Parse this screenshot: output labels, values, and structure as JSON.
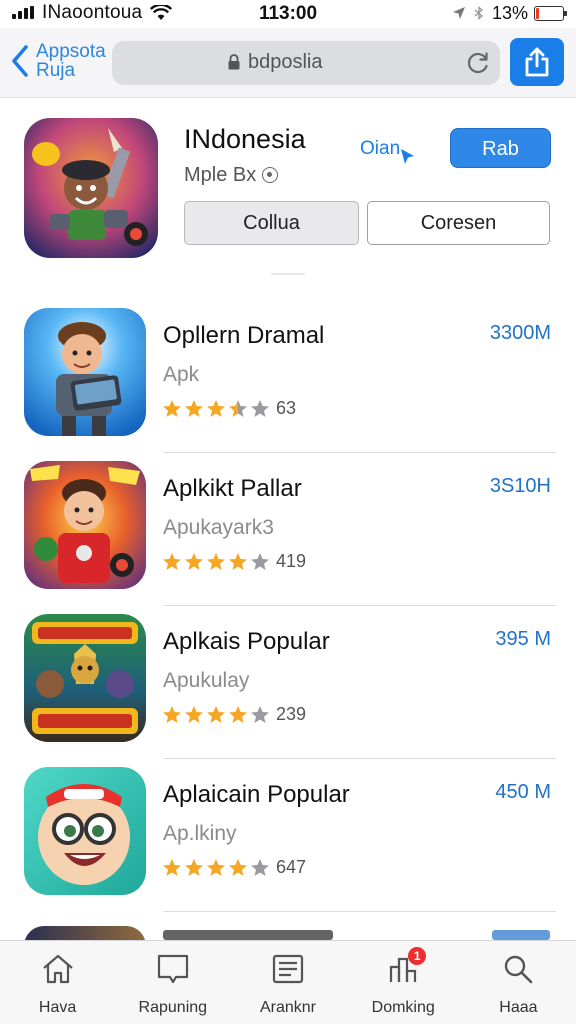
{
  "status_bar": {
    "carrier": "INaoontoua",
    "time": "113:00",
    "battery_percent": "13%",
    "battery_level": 0.13
  },
  "nav": {
    "back_label_line1": "Appsota",
    "back_label_line2": "Ruja",
    "url": "bdposlia",
    "accent": "#1a7ee8"
  },
  "featured": {
    "title": "INdonesia",
    "subtitle": "Mple Bx",
    "link": "Oian",
    "get_label": "Rab",
    "segment_1": "Collua",
    "segment_2": "Coresen"
  },
  "apps": [
    {
      "name": "Opllern Dramal",
      "subtitle": "Apk",
      "rating": 3.5,
      "rating_count": "63",
      "size": "3300M"
    },
    {
      "name": "Aplkikt Pallar",
      "subtitle": "Apukayark3",
      "rating": 4,
      "rating_count": "419",
      "size": "3S10H"
    },
    {
      "name": "Aplkais Popular",
      "subtitle": "Apukulay",
      "rating": 4,
      "rating_count": "239",
      "size": "395 M"
    },
    {
      "name": "Aplaicain Popular",
      "subtitle": "Ap.lkiny",
      "rating": 4,
      "rating_count": "647",
      "size": "450 M"
    }
  ],
  "tabs": [
    {
      "label": "Hava",
      "icon": "home-icon"
    },
    {
      "label": "Rapuning",
      "icon": "chat-icon"
    },
    {
      "label": "Aranknr",
      "icon": "list-icon"
    },
    {
      "label": "Domking",
      "icon": "ranking-icon",
      "badge": "1"
    },
    {
      "label": "Haaa",
      "icon": "search-icon"
    }
  ]
}
